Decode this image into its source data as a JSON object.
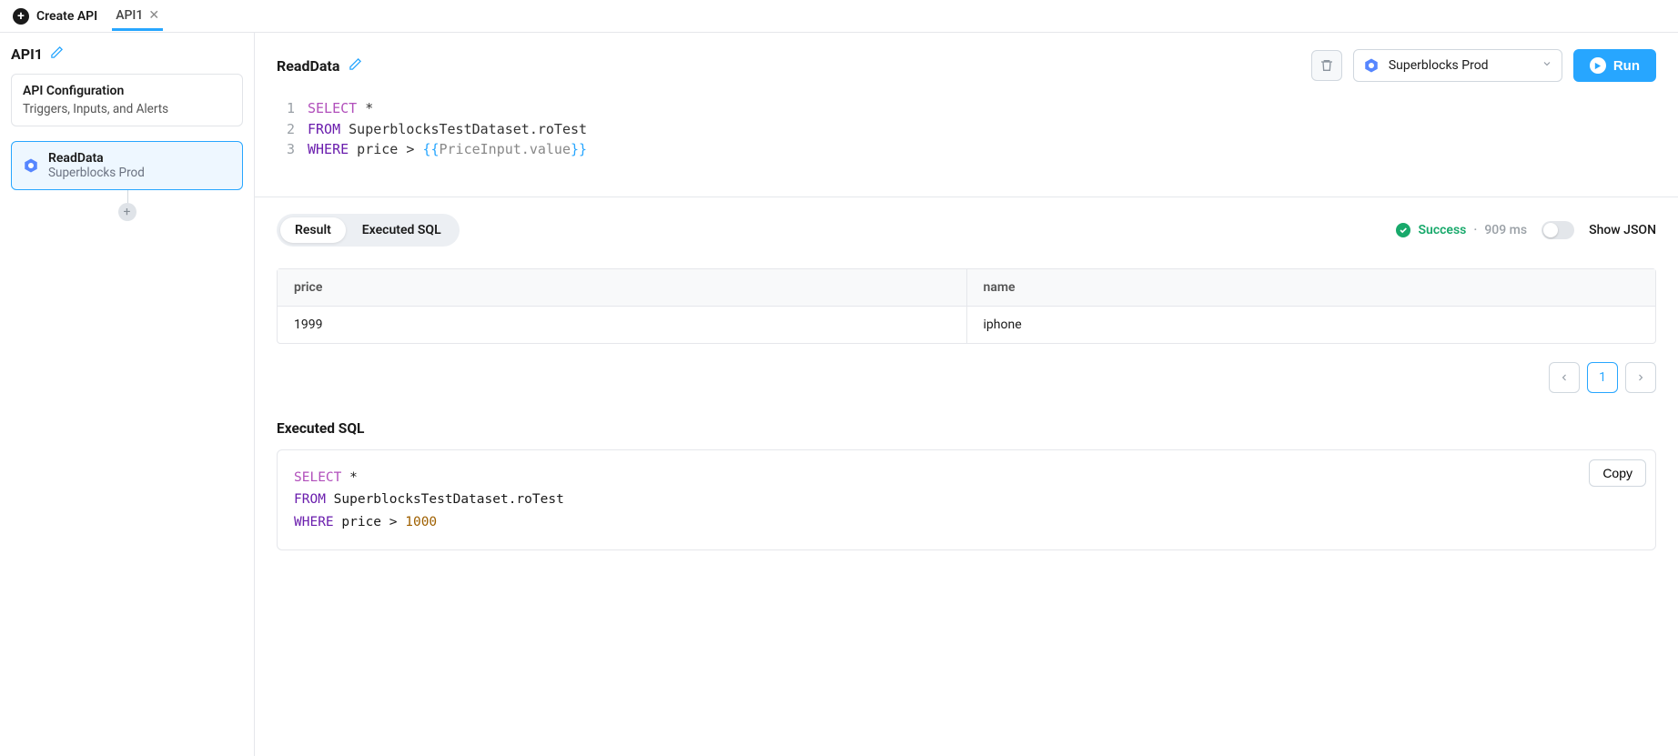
{
  "topbar": {
    "create_label": "Create API",
    "tab_label": "API1"
  },
  "sidebar": {
    "api_title": "API1",
    "config_title": "API Configuration",
    "config_sub": "Triggers, Inputs, and Alerts",
    "step_name": "ReadData",
    "step_ds": "Superblocks Prod"
  },
  "header": {
    "title": "ReadData",
    "datasource": "Superblocks Prod",
    "run_label": "Run"
  },
  "editor": {
    "ln1": "1",
    "ln2": "2",
    "ln3": "3",
    "select": "SELECT",
    "star": " *",
    "from": "FROM",
    "table": " SuperblocksTestDataset.roTest",
    "where": "WHERE",
    "cond": " price > ",
    "brace_open": "{{",
    "brace_close": "}}",
    "expr": "PriceInput.value"
  },
  "tabs": {
    "result": "Result",
    "executed": "Executed SQL"
  },
  "status": {
    "label": "Success",
    "time": "909 ms",
    "dot": "·",
    "showjson": "Show JSON"
  },
  "table": {
    "h1": "price",
    "h2": "name",
    "r1c1": "1999",
    "r1c2": "iphone"
  },
  "pager": {
    "page": "1"
  },
  "exec": {
    "title": "Executed SQL",
    "copy": "Copy",
    "select": "SELECT",
    "star": " *",
    "from": "FROM",
    "table": " SuperblocksTestDataset.roTest",
    "where": "WHERE",
    "cond": " price > ",
    "val": "1000"
  }
}
